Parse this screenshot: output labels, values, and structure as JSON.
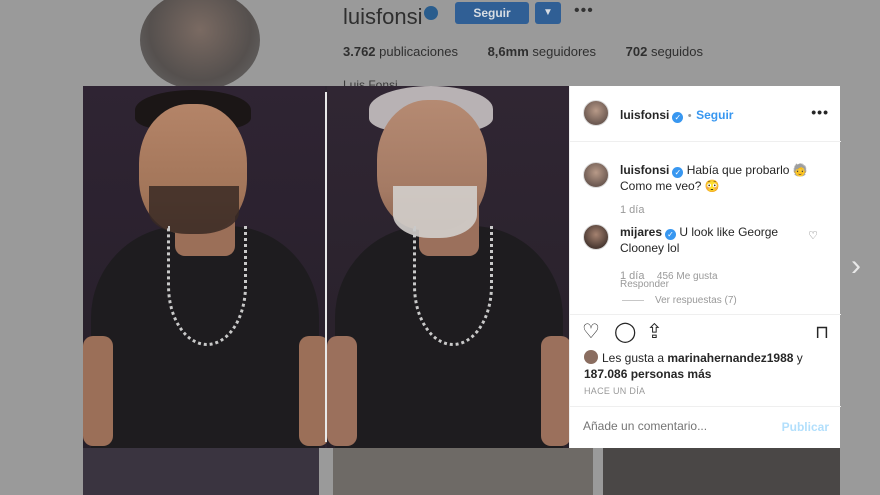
{
  "profile": {
    "username": "luisfonsi",
    "follow_label": "Seguir",
    "dropdown_icon": "chevron-down-icon",
    "more_icon": "more-horizontal-icon",
    "posts_count": "3.762",
    "posts_label": "publicaciones",
    "followers_count": "8,6mm",
    "followers_label": "seguidores",
    "following_count": "702",
    "following_label": "seguidos",
    "name": "Luis Fonsi"
  },
  "post": {
    "author": "luisfonsi",
    "follow_link": "Seguir",
    "separator": "•",
    "caption": "Había que probarlo 🧓 Como me veo? 😳",
    "caption_age": "1 día",
    "comments": [
      {
        "user": "mijares",
        "text": "U look like George Clooney lol",
        "age": "1 día",
        "likes": "456 Me gusta",
        "reply_label": "Responder",
        "view_replies": "Ver respuestas (7)"
      }
    ],
    "likes_prefix": "Les gusta a",
    "likes_user": "marinahernandez1988",
    "likes_and": "y",
    "likes_count": "187.086 personas más",
    "timestamp": "HACE UN DÍA",
    "comment_placeholder": "Añade un comentario...",
    "post_button": "Publicar"
  },
  "colors": {
    "accent": "#3897f0",
    "text": "#262626",
    "muted": "#999999"
  }
}
